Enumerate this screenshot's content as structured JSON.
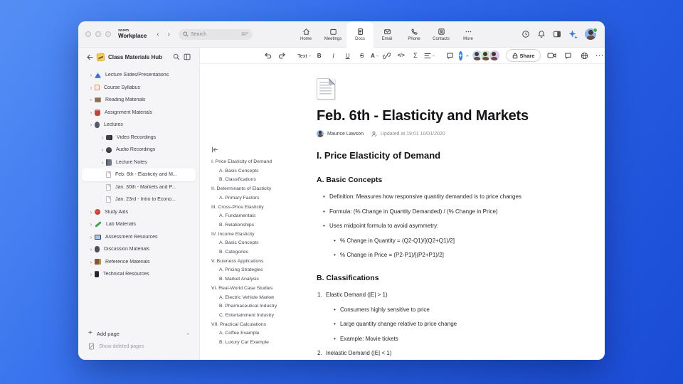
{
  "window": {
    "logo": {
      "top": "zoom",
      "bottom": "Workplace"
    },
    "search": {
      "placeholder": "Search",
      "shortcut": "⌘F"
    },
    "nav_tabs": [
      {
        "label": "Home"
      },
      {
        "label": "Meetings"
      },
      {
        "label": "Docs"
      },
      {
        "label": "Email"
      },
      {
        "label": "Phone"
      },
      {
        "label": "Contacts"
      },
      {
        "label": "More"
      }
    ]
  },
  "sidebar": {
    "title": "Class Materials Hub",
    "items": [
      {
        "label": "Lecture Slides/Presentations",
        "icon": "slides",
        "level": 0,
        "chevron": true,
        "expanded": false
      },
      {
        "label": "Course Syllabus",
        "icon": "syllabus",
        "level": 0,
        "chevron": true,
        "expanded": false
      },
      {
        "label": "Reading Materials",
        "icon": "reading",
        "level": 0,
        "chevron": true,
        "expanded": true
      },
      {
        "label": "Assignment Materials",
        "icon": "assignment",
        "level": 0,
        "chevron": true,
        "expanded": false
      },
      {
        "label": "Lectures",
        "icon": "lectures",
        "level": 0,
        "chevron": true,
        "expanded": false
      },
      {
        "label": "Video Recordings",
        "icon": "video",
        "level": 1,
        "chevron": true,
        "expanded": false
      },
      {
        "label": "Audio Recordings",
        "icon": "audio",
        "level": 1,
        "chevron": true,
        "expanded": false
      },
      {
        "label": "Lecture Notes",
        "icon": "notes",
        "level": 1,
        "chevron": true,
        "expanded": false
      },
      {
        "label": "Feb. 6th - Elasticity and M...",
        "icon": "page",
        "level": 2,
        "chevron": false,
        "selected": true
      },
      {
        "label": "Jan. 30th - Markets and P...",
        "icon": "page",
        "level": 2,
        "chevron": false
      },
      {
        "label": "Jan. 23rd - Intro to Econo...",
        "icon": "page",
        "level": 2,
        "chevron": false
      },
      {
        "label": "Study Aids",
        "icon": "study",
        "level": 0,
        "chevron": true,
        "expanded": false
      },
      {
        "label": "Lab Materials",
        "icon": "lab",
        "level": 0,
        "chevron": true,
        "expanded": false
      },
      {
        "label": "Assessment Resources",
        "icon": "assessment",
        "level": 0,
        "chevron": true,
        "expanded": false
      },
      {
        "label": "Discussion Materials",
        "icon": "discussion",
        "level": 0,
        "chevron": true,
        "expanded": false
      },
      {
        "label": "Reference Materials",
        "icon": "reference",
        "level": 0,
        "chevron": true,
        "expanded": false
      },
      {
        "label": "Technical Resources",
        "icon": "technical",
        "level": 0,
        "chevron": true,
        "expanded": false
      }
    ],
    "footer": {
      "add_page": "Add page",
      "show_deleted": "Show deleted pages"
    }
  },
  "toolbar": {
    "text_style": "Text",
    "share_label": "Share"
  },
  "outline": {
    "items": [
      {
        "text": "I. Price Elasticity of Demand",
        "level": 0
      },
      {
        "text": "A. Basic Concepts",
        "level": 1
      },
      {
        "text": "B. Classifications",
        "level": 1
      },
      {
        "text": "II. Determinants of Elasticity",
        "level": 0
      },
      {
        "text": "A. Primary Factors",
        "level": 1
      },
      {
        "text": "III. Cross-Price Elasticity",
        "level": 0
      },
      {
        "text": "A. Fundamentals",
        "level": 1
      },
      {
        "text": "B. Relationships",
        "level": 1
      },
      {
        "text": "IV. Income Elasticity",
        "level": 0
      },
      {
        "text": "A. Basic Concepts",
        "level": 1
      },
      {
        "text": "B. Categories",
        "level": 1
      },
      {
        "text": "V. Business Applications",
        "level": 0
      },
      {
        "text": "A. Pricing Strategies",
        "level": 1
      },
      {
        "text": "B. Market Analysis",
        "level": 1
      },
      {
        "text": "VI. Real-World Case Studies",
        "level": 0
      },
      {
        "text": "A. Electric Vehicle Market",
        "level": 1
      },
      {
        "text": "B. Pharmaceutical Industry",
        "level": 1
      },
      {
        "text": "C. Entertainment Industry",
        "level": 1
      },
      {
        "text": "VII. Practical Calculations",
        "level": 0
      },
      {
        "text": "A. Coffee Example",
        "level": 1
      },
      {
        "text": "B. Luxury Car Example",
        "level": 1
      }
    ]
  },
  "doc": {
    "title": "Feb. 6th - Elasticity and Markets",
    "author": "Maurice Lawson",
    "updated": "Updated at 19:01 10/01/2020",
    "blocks": [
      {
        "type": "h2",
        "text": "I. Price Elasticity of Demand"
      },
      {
        "type": "h3",
        "text": "A. Basic Concepts"
      },
      {
        "type": "li1",
        "marker": "•",
        "text": "Definition: Measures how responsive quantity demanded is to price changes"
      },
      {
        "type": "li1",
        "marker": "•",
        "text": "Formula: (% Change in Quantity Demanded) / (% Change in Price)"
      },
      {
        "type": "li1",
        "marker": "•",
        "text": "Uses midpoint formula to avoid asymmetry:"
      },
      {
        "type": "li2",
        "marker": "•",
        "text": "% Change in Quantity = (Q2-Q1)/[(Q2+Q1)/2]"
      },
      {
        "type": "li2",
        "marker": "•",
        "text": "% Change in Price = (P2-P1)/[(P2+P1)/2]"
      },
      {
        "type": "h3",
        "text": "B. Classifications"
      },
      {
        "type": "num",
        "marker": "1.",
        "text": "Elastic Demand (|E| > 1)"
      },
      {
        "type": "li2",
        "marker": "•",
        "text": "Consumers highly sensitive to price"
      },
      {
        "type": "li2",
        "marker": "•",
        "text": "Large quantity change relative to price change"
      },
      {
        "type": "li2",
        "marker": "•",
        "text": "Example: Movie tickets"
      },
      {
        "type": "num",
        "marker": "2.",
        "text": "Inelastic Demand (|E| < 1)"
      }
    ]
  },
  "colors": {
    "accent": "#2e7bf6",
    "presence_green": "#2fb457"
  }
}
